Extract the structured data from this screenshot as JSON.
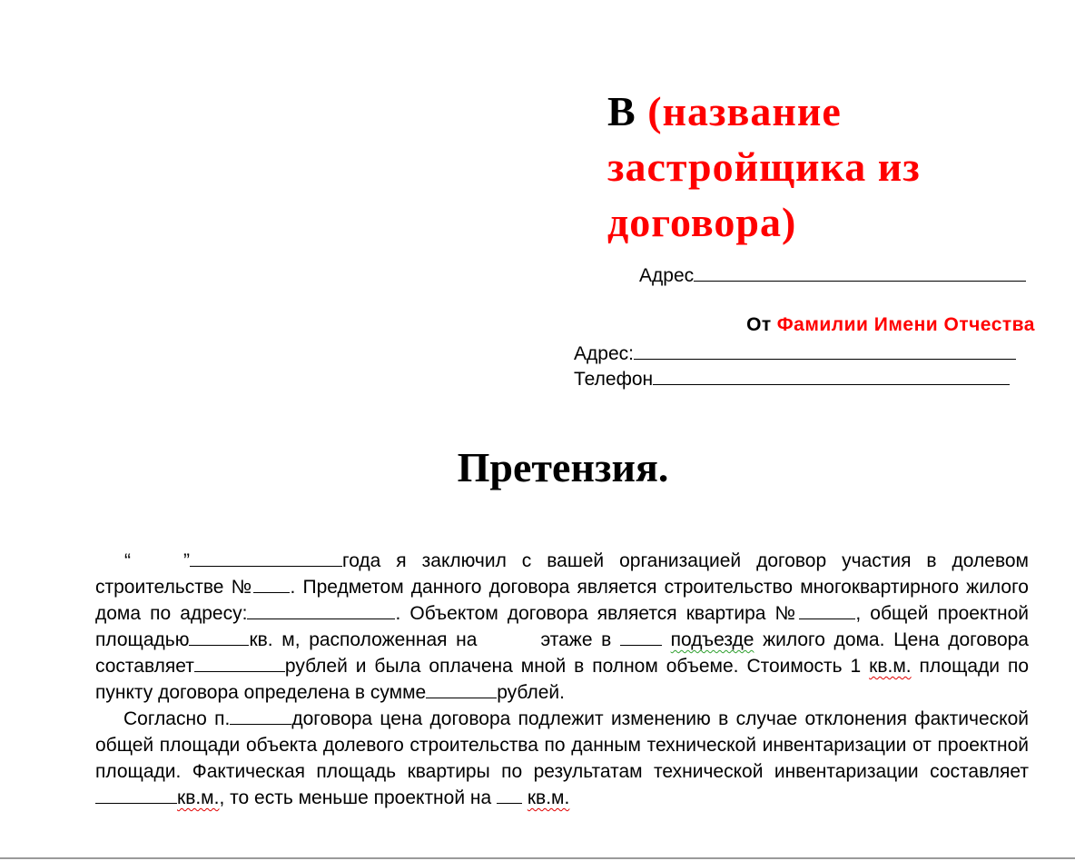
{
  "recipient": {
    "prefix": "В",
    "placeholder": "(название застройщика из договора)",
    "address_label": "Адрес"
  },
  "sender": {
    "from_label": "От",
    "name_placeholder": "Фамилии Имени Отчества",
    "address_label": "Адрес:",
    "phone_label": "Телефон"
  },
  "title": "Претензия.",
  "paragraph1": {
    "quote_open": "“",
    "quote_close": "”",
    "s1": "года я заключил с вашей организацией договор участия в долевом строительстве №",
    "s2": ". Предметом данного договора является строительство многоквартирного жилого дома по адресу:",
    "s3": ". Объектом договора является квартира №",
    "s4": ", общей проектной площадью",
    "s5": "кв. м, расположенная на",
    "s6": "этаже в",
    "s7": "подъезде",
    "s8": " жилого дома. Цена договора составляет",
    "s9": "рублей и была оплачена мной в полном объеме. Стоимость 1 ",
    "s10": "кв.м.",
    "s11": " площади по пункту  договора определена в сумме",
    "s12": "рублей."
  },
  "paragraph2": {
    "s1": "Согласно п.",
    "s2": "договора цена договора подлежит изменению в случае отклонения фактической общей площади объекта долевого строительства по данным  технической инвентаризации от проектной площади. Фактическая площадь квартиры по результатам технической инвентаризации составляет",
    "s3": "кв.м.",
    "s4": ", то есть меньше проектной на ",
    "s5": "кв.м."
  },
  "colors": {
    "placeholder": "#ff0000",
    "text": "#000000"
  }
}
